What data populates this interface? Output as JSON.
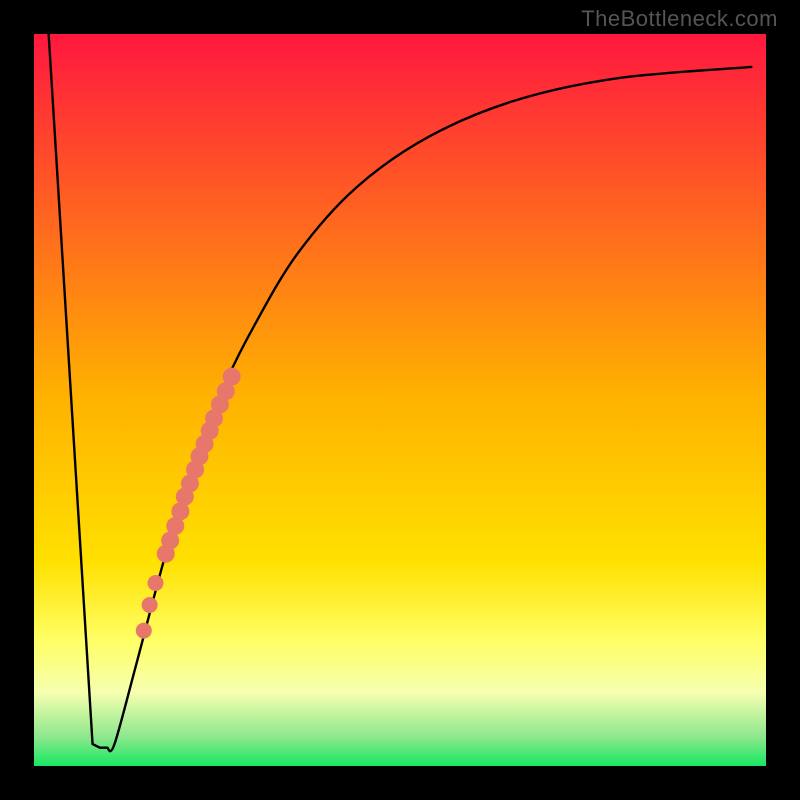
{
  "watermark": "TheBottleneck.com",
  "chart_data": {
    "type": "line",
    "title": "",
    "xlabel": "",
    "ylabel": "",
    "xlim": [
      0,
      100
    ],
    "ylim": [
      0,
      100
    ],
    "background_gradient": {
      "stops": [
        {
          "offset": 0.0,
          "color": "#ff173f"
        },
        {
          "offset": 0.5,
          "color": "#ffb300"
        },
        {
          "offset": 0.72,
          "color": "#ffe000"
        },
        {
          "offset": 0.83,
          "color": "#ffff66"
        },
        {
          "offset": 0.9,
          "color": "#f5ffb0"
        },
        {
          "offset": 0.96,
          "color": "#8de88d"
        },
        {
          "offset": 1.0,
          "color": "#18e761"
        }
      ]
    },
    "series": [
      {
        "name": "bottleneck-curve",
        "x": [
          2.0,
          8.0,
          9.0,
          10.0,
          11.0,
          14.0,
          18.0,
          22.0,
          26.0,
          30.0,
          36.0,
          44.0,
          54.0,
          66.0,
          80.0,
          98.0
        ],
        "y": [
          100.0,
          3.0,
          2.5,
          2.5,
          3.0,
          14.0,
          29.0,
          42.0,
          52.0,
          60.0,
          70.0,
          79.0,
          86.0,
          91.0,
          94.0,
          95.5
        ]
      }
    ],
    "highlight_points": {
      "name": "red-dot-cluster",
      "color": "#e8776b",
      "points": [
        {
          "x": 18.0,
          "y": 29.0
        },
        {
          "x": 18.6,
          "y": 30.8
        },
        {
          "x": 19.3,
          "y": 32.8
        },
        {
          "x": 20.0,
          "y": 34.8
        },
        {
          "x": 20.6,
          "y": 36.8
        },
        {
          "x": 21.3,
          "y": 38.6
        },
        {
          "x": 22.0,
          "y": 40.5
        },
        {
          "x": 22.6,
          "y": 42.3
        },
        {
          "x": 23.3,
          "y": 44.0
        },
        {
          "x": 24.0,
          "y": 45.8
        },
        {
          "x": 24.6,
          "y": 47.5
        },
        {
          "x": 25.4,
          "y": 49.4
        },
        {
          "x": 26.2,
          "y": 51.2
        },
        {
          "x": 27.0,
          "y": 53.2
        }
      ],
      "sparse_points": [
        {
          "x": 16.6,
          "y": 25.0
        },
        {
          "x": 15.8,
          "y": 22.0
        },
        {
          "x": 15.0,
          "y": 18.5
        }
      ]
    }
  }
}
